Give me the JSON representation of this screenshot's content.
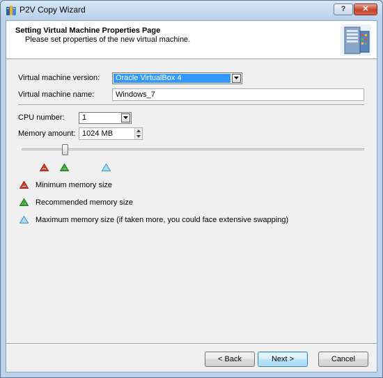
{
  "window": {
    "title": "P2V Copy Wizard",
    "help_label": "?",
    "close_label": "✕"
  },
  "header": {
    "title": "Setting Virtual Machine Properties Page",
    "subtitle": "Please set properties of the new virtual machine."
  },
  "form": {
    "vm_version_label": "Virtual machine version:",
    "vm_version_value": "Oracle VirtualBox 4",
    "vm_name_label": "Virtual machine name:",
    "vm_name_value": "Windows_7",
    "cpu_label": "CPU number:",
    "cpu_value": "1",
    "memory_label": "Memory amount:",
    "memory_value": "1024 MB"
  },
  "legend": {
    "min_label": "Minimum memory size",
    "recommended_label": "Recommended memory size",
    "max_label": "Maximum memory size (if taken more, you could face extensive swapping)"
  },
  "footer": {
    "back_label": "< Back",
    "next_label": "Next >",
    "cancel_label": "Cancel"
  },
  "colors": {
    "selected_highlight": "#3399ff",
    "min_marker": "#e03a2c",
    "recommended_marker": "#3fae3a",
    "max_marker": "#7ec8ef"
  }
}
